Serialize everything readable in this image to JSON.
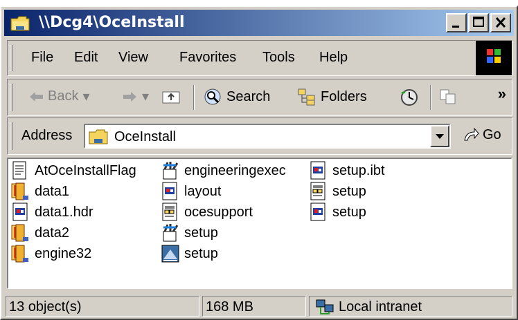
{
  "window": {
    "title": "\\\\Dcg4\\OceInstall",
    "minimize": "minimize",
    "maximize": "maximize",
    "close": "close"
  },
  "menubar": {
    "items": [
      "File",
      "Edit",
      "View",
      "Favorites",
      "Tools",
      "Help"
    ]
  },
  "toolbar": {
    "back": "Back",
    "search": "Search",
    "folders": "Folders"
  },
  "address": {
    "label": "Address",
    "value": "OceInstall",
    "go": "Go"
  },
  "files": [
    {
      "name": "AtOceInstallFlag",
      "icon": "text-file-icon"
    },
    {
      "name": "data1",
      "icon": "cab-archive-icon"
    },
    {
      "name": "data1.hdr",
      "icon": "generic-file-icon"
    },
    {
      "name": "data2",
      "icon": "cab-archive-icon"
    },
    {
      "name": "engine32",
      "icon": "cab-archive-icon"
    },
    {
      "name": "engineeringexec",
      "icon": "installer-icon"
    },
    {
      "name": "layout",
      "icon": "generic-file-icon"
    },
    {
      "name": "ocesupport",
      "icon": "config-file-icon"
    },
    {
      "name": "setup",
      "icon": "installer-icon"
    },
    {
      "name": "setup",
      "icon": "setup-exe-icon"
    },
    {
      "name": "setup.ibt",
      "icon": "generic-file-icon"
    },
    {
      "name": "setup",
      "icon": "config-file-icon"
    },
    {
      "name": "setup",
      "icon": "generic-file-icon"
    }
  ],
  "statusbar": {
    "count": "13 object(s)",
    "size": "168 MB",
    "zone": "Local intranet"
  }
}
